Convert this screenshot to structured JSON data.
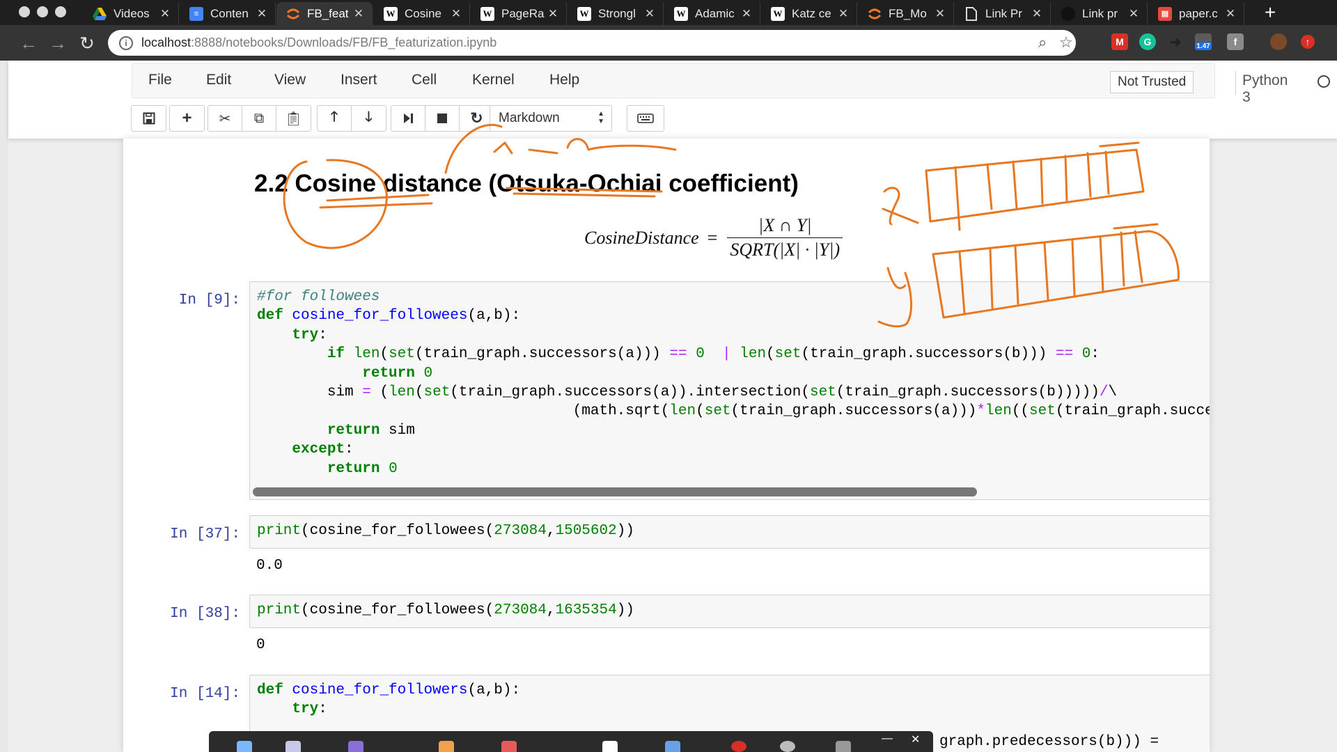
{
  "browser": {
    "tabs": [
      {
        "label": "Videos",
        "icon": "google-drive-icon",
        "active": false
      },
      {
        "label": "Conten",
        "icon": "google-docs-icon",
        "active": false
      },
      {
        "label": "FB_feat",
        "icon": "jupyter-icon",
        "active": true
      },
      {
        "label": "Cosine",
        "icon": "wikipedia-icon",
        "active": false
      },
      {
        "label": "PageRa",
        "icon": "wikipedia-icon",
        "active": false
      },
      {
        "label": "Strongl",
        "icon": "wikipedia-icon",
        "active": false
      },
      {
        "label": "Adamic",
        "icon": "wikipedia-icon",
        "active": false
      },
      {
        "label": "Katz ce",
        "icon": "wikipedia-icon",
        "active": false
      },
      {
        "label": "FB_Mo",
        "icon": "jupyter-icon",
        "active": false
      },
      {
        "label": "Link Pr",
        "icon": "document-icon",
        "active": false
      },
      {
        "label": "Link pr",
        "icon": "github-icon",
        "active": false
      },
      {
        "label": "paper.c",
        "icon": "pdf-icon",
        "active": false
      }
    ],
    "url_host": "localhost",
    "url_rest": ":8888/notebooks/Downloads/FB/FB_featurization.ipynb",
    "extension_badge": "1.47"
  },
  "jupyter": {
    "menu": [
      "File",
      "Edit",
      "View",
      "Insert",
      "Cell",
      "Kernel",
      "Help"
    ],
    "trust": "Not Trusted",
    "kernel": "Python 3",
    "cell_type": "Markdown"
  },
  "notebook": {
    "heading": "2.2 Cosine distance (Otsuka-Ochiai coefficient)",
    "formula_lhs": "CosineDistance",
    "formula_eq": "=",
    "formula_num": "|X ∩ Y|",
    "formula_den": "SQRT(|X| · |Y|)",
    "cells": [
      {
        "prompt": "In [9]:"
      },
      {
        "prompt": "In [37]:",
        "output": "0.0"
      },
      {
        "prompt": "In [38]:",
        "output": "0"
      },
      {
        "prompt": "In [14]:"
      }
    ],
    "partial_text": "graph.predecessors(b))) ="
  },
  "annotations": {
    "label_x": "x",
    "label_y": "y",
    "ink_color": "#e87722"
  },
  "colors": {
    "prompt": "#303f9f",
    "keyword": "#008000",
    "defname": "#0000ff",
    "comment": "#408080",
    "operator": "#aa22ff"
  }
}
